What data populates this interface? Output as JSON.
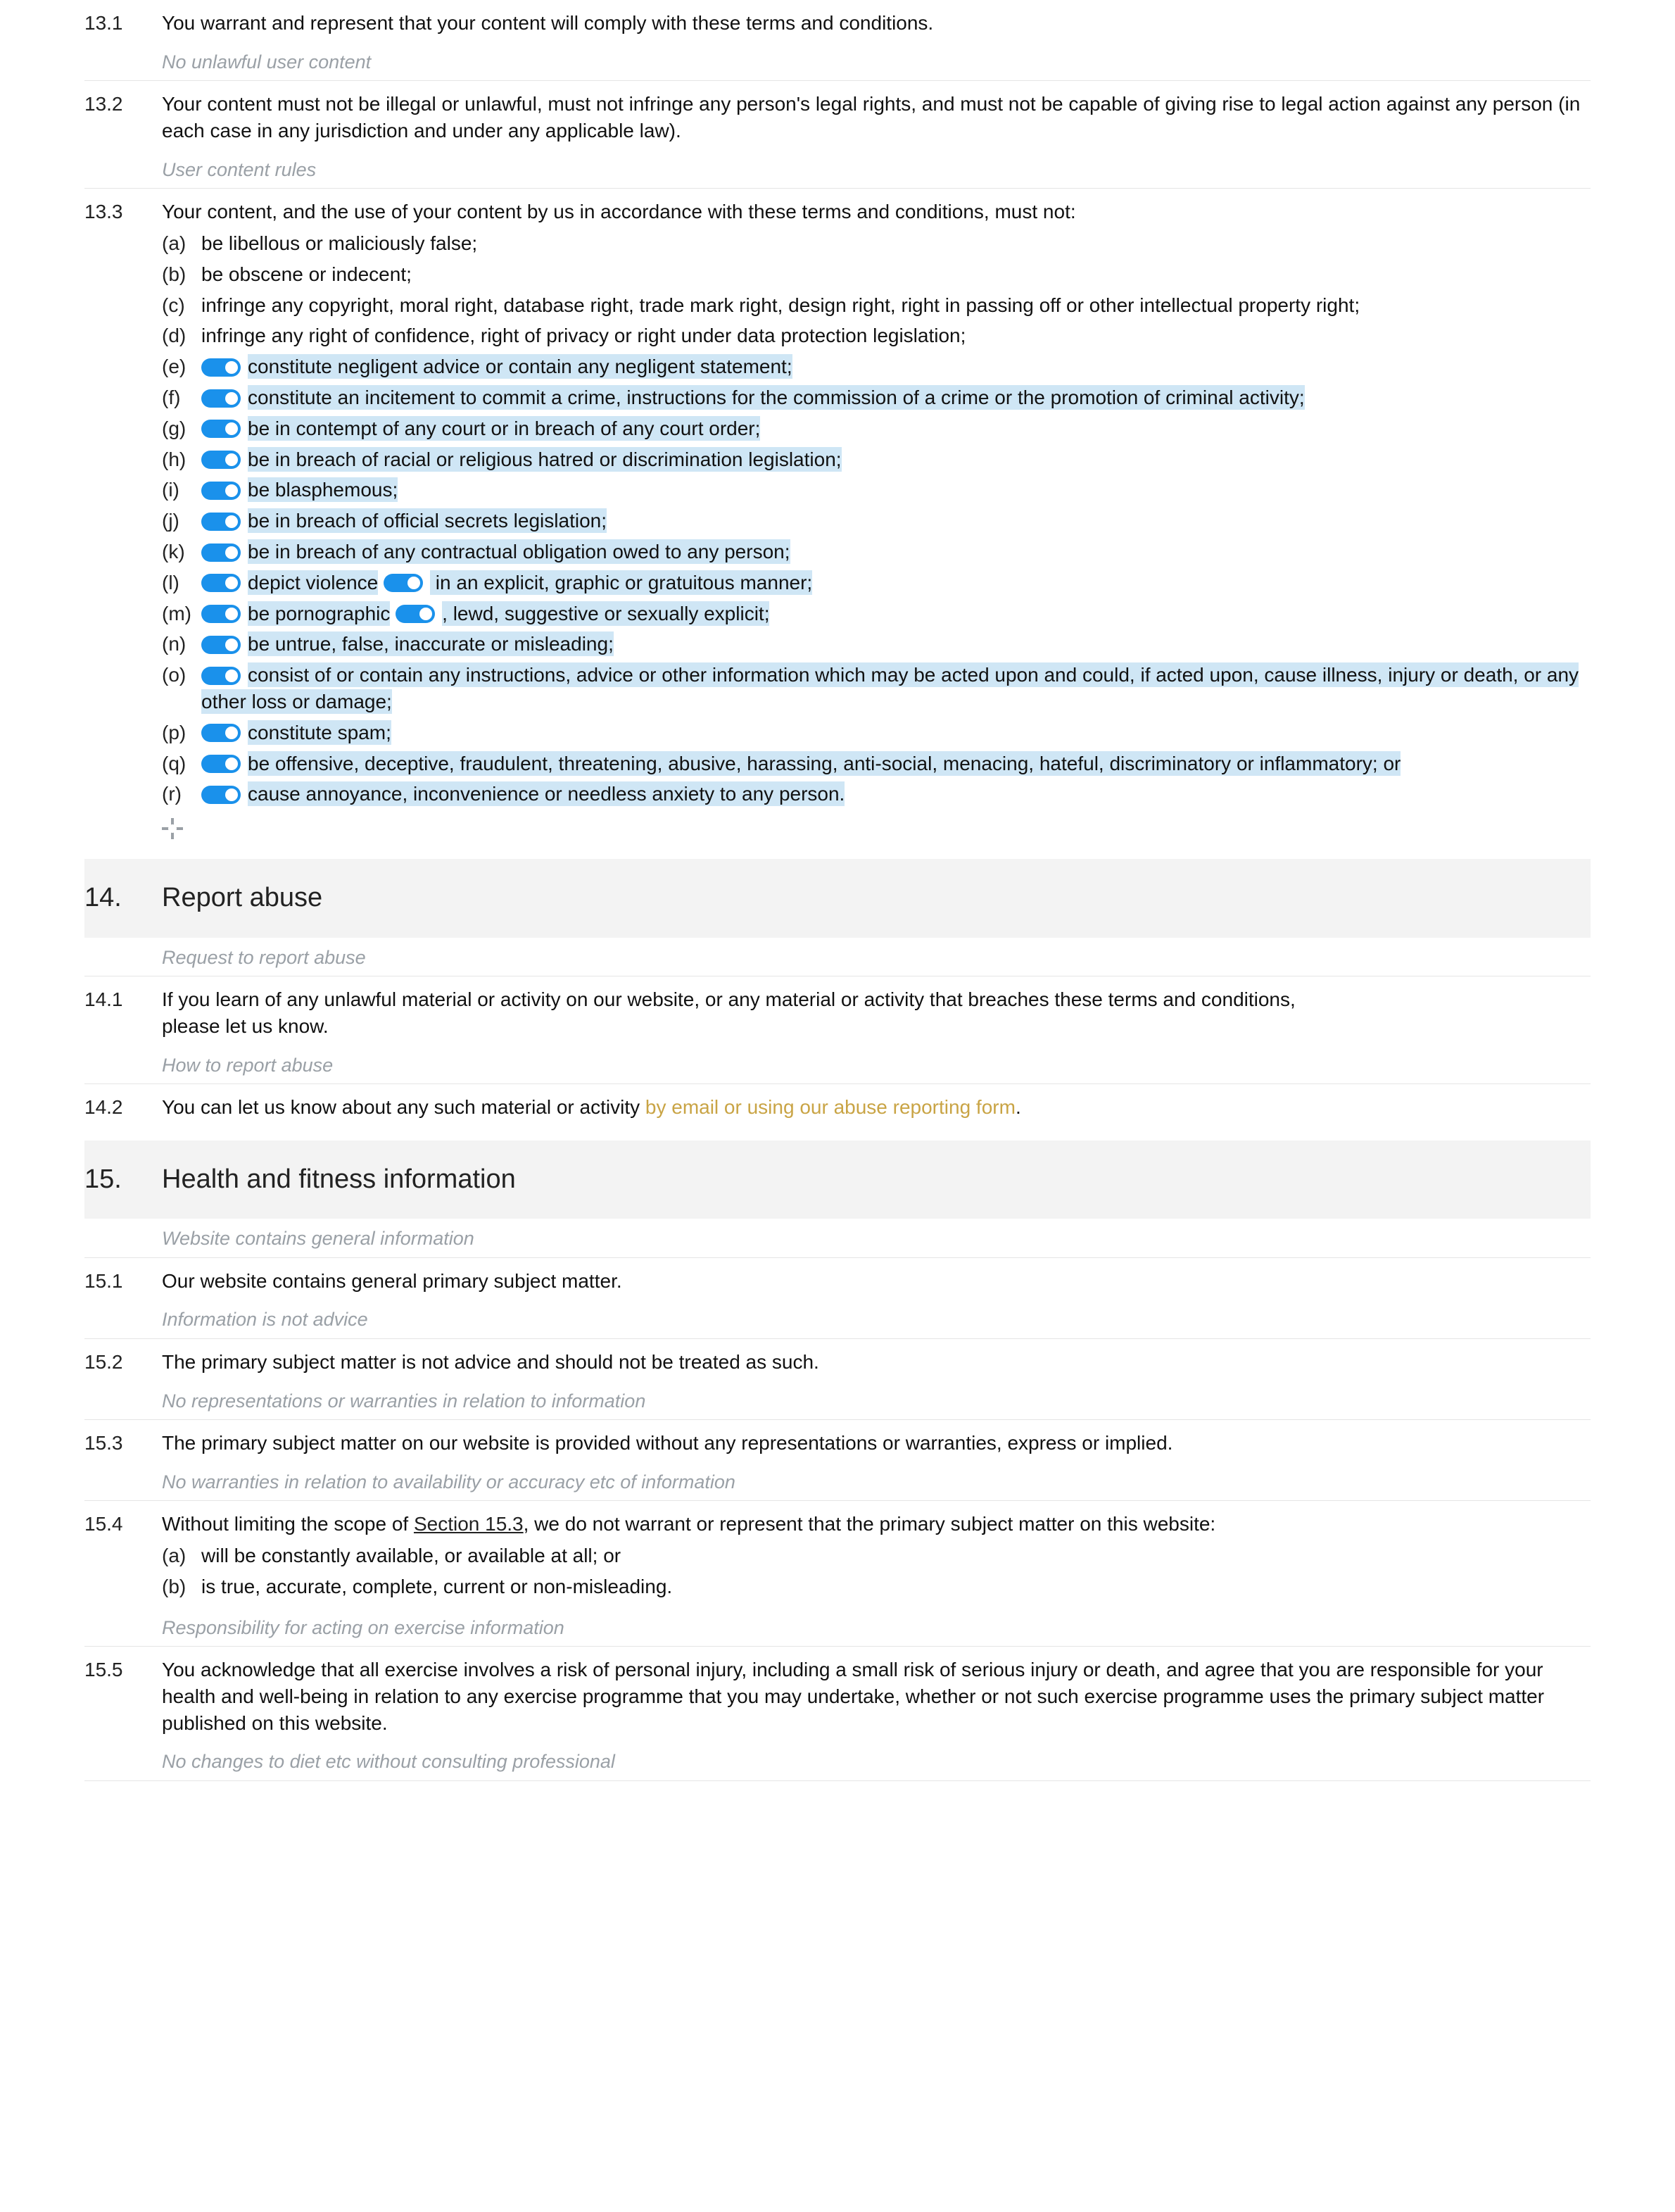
{
  "s13": {
    "c1": {
      "num": "13.1",
      "text": "You warrant and represent that your content will comply with these terms and conditions.",
      "annot": "No unlawful user content"
    },
    "c2": {
      "num": "13.2",
      "text": "Your content must not be illegal or unlawful, must not infringe any person's legal rights, and must not be capable of giving rise to legal action against any person (in each case in any jurisdiction and under any applicable law).",
      "annot": "User content rules"
    },
    "c3": {
      "num": "13.3",
      "intro": "Your content, and the use of your content by us in accordance with these terms and conditions, must not:",
      "items": {
        "a": {
          "l": "(a)",
          "t": "be libellous or maliciously false;"
        },
        "b": {
          "l": "(b)",
          "t": "be obscene or indecent;"
        },
        "c": {
          "l": "(c)",
          "t": "infringe any copyright, moral right, database right, trade mark right, design right, right in passing off or other intellectual property right;"
        },
        "d": {
          "l": "(d)",
          "t": "infringe any right of confidence, right of privacy or right under data protection legislation;"
        },
        "e": {
          "l": "(e)",
          "t": "constitute negligent advice or contain any negligent statement;"
        },
        "f": {
          "l": "(f)",
          "t": "constitute an incitement to commit a crime, instructions for the commission of a crime or the promotion of criminal activity;"
        },
        "g": {
          "l": "(g)",
          "t": "be in contempt of any court or in breach of any court order;"
        },
        "h": {
          "l": "(h)",
          "t": "be in breach of racial or religious hatred or discrimination legislation;"
        },
        "i": {
          "l": "(i)",
          "t": "be blasphemous;"
        },
        "j": {
          "l": "(j)",
          "t": "be in breach of official secrets legislation;"
        },
        "k": {
          "l": "(k)",
          "t": "be in breach of any contractual obligation owed to any person;"
        },
        "l": {
          "l": "(l)",
          "t1": "depict violence",
          "t2": " in an explicit, graphic or gratuitous manner;"
        },
        "m": {
          "l": "(m)",
          "t1": "be pornographic",
          "t2": ", lewd, suggestive or sexually explicit;"
        },
        "n": {
          "l": "(n)",
          "t": "be untrue, false, inaccurate or misleading;"
        },
        "o": {
          "l": "(o)",
          "t": "consist of or contain any instructions, advice or other information which may be acted upon and could, if acted upon, cause illness, injury or death, or any other loss or damage;"
        },
        "p": {
          "l": "(p)",
          "t": "constitute spam;"
        },
        "q": {
          "l": "(q)",
          "t": "be offensive, deceptive, fraudulent, threatening, abusive, harassing, anti-social, menacing, hateful, discriminatory or inflammatory; or"
        },
        "r": {
          "l": "(r)",
          "t": "cause annoyance, inconvenience or needless anxiety to any person."
        }
      }
    }
  },
  "s14": {
    "num": "14.",
    "title": "Report abuse",
    "annot1": "Request to report abuse",
    "c1": {
      "num": "14.1",
      "text": "If you learn of any unlawful material or activity on our website, or any material or activity that breaches these terms and conditions, please let us know."
    },
    "annot2": "How to report abuse",
    "c2": {
      "num": "14.2",
      "pre": "You can let us know about any such material or activity ",
      "link": "by email or using our abuse reporting form",
      "post": "."
    }
  },
  "s15": {
    "num": "15.",
    "title": "Health and fitness information",
    "annot1": "Website contains general information",
    "c1": {
      "num": "15.1",
      "text": "Our website contains general primary subject matter."
    },
    "annot2": "Information is not advice",
    "c2": {
      "num": "15.2",
      "text": "The primary subject matter is not advice and should not be treated as such."
    },
    "annot3": "No representations or warranties in relation to information",
    "c3": {
      "num": "15.3",
      "text": "The primary subject matter on our website is provided without any representations or warranties, express or implied."
    },
    "annot4": "No warranties in relation to availability or accuracy etc of information",
    "c4": {
      "num": "15.4",
      "pre": "Without limiting the scope of ",
      "ref": "Section 15.3",
      "post": ", we do not warrant or represent that the primary subject matter on this website:",
      "a": {
        "l": "(a)",
        "t": "will be constantly available, or available at all; or"
      },
      "b": {
        "l": "(b)",
        "t": "is true, accurate, complete, current or non-misleading."
      }
    },
    "annot5": "Responsibility for acting on exercise information",
    "c5": {
      "num": "15.5",
      "text": "You acknowledge that all exercise involves a risk of personal injury, including a small risk of serious injury or death, and agree that you are responsible for your health and well-being in relation to any exercise programme that you may undertake, whether or not such exercise programme uses the primary subject matter published on this website."
    },
    "annot6": "No changes to diet etc without consulting professional"
  }
}
